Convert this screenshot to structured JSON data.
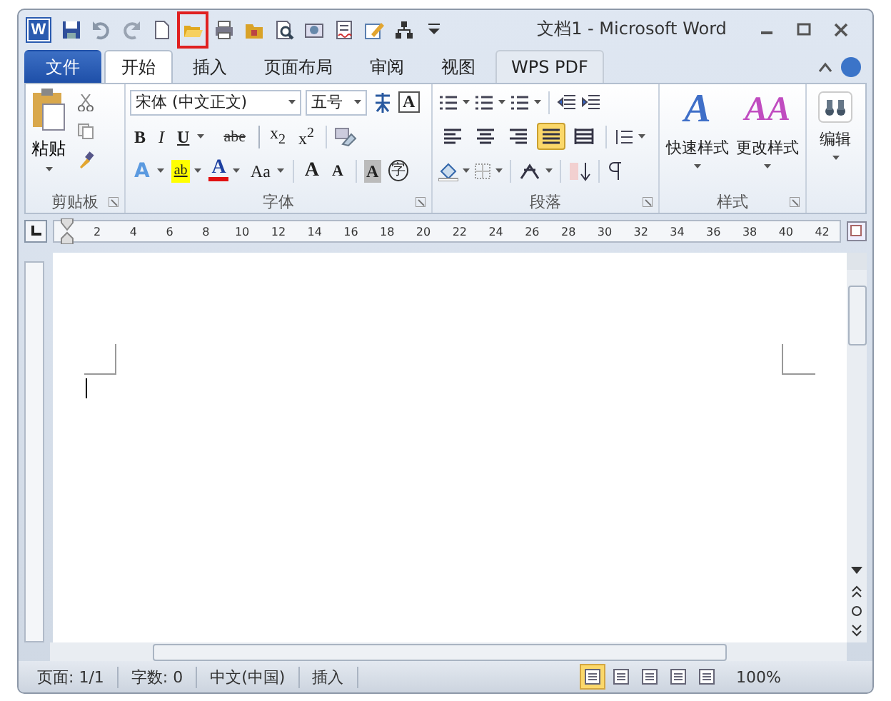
{
  "window": {
    "app_icon": "W",
    "title": "文档1 - Microsoft Word"
  },
  "quick_access": [
    {
      "kind": "save",
      "highlighted": false
    },
    {
      "kind": "undo",
      "highlighted": false
    },
    {
      "kind": "redo",
      "highlighted": false
    },
    {
      "kind": "new",
      "highlighted": false
    },
    {
      "kind": "open",
      "highlighted": true
    },
    {
      "kind": "print",
      "highlighted": false
    },
    {
      "kind": "folder",
      "highlighted": false
    },
    {
      "kind": "preview",
      "highlighted": false
    },
    {
      "kind": "picture",
      "highlighted": false
    },
    {
      "kind": "spell",
      "highlighted": false
    },
    {
      "kind": "edit",
      "highlighted": false
    },
    {
      "kind": "chart",
      "highlighted": false
    },
    {
      "kind": "customize",
      "highlighted": false
    }
  ],
  "tabs": [
    {
      "label": "文件",
      "kind": "file",
      "selected": false
    },
    {
      "label": "开始",
      "kind": "tab",
      "selected": true
    },
    {
      "label": "插入",
      "kind": "tab",
      "selected": false
    },
    {
      "label": "页面布局",
      "kind": "tab",
      "selected": false
    },
    {
      "label": "审阅",
      "kind": "tab",
      "selected": false
    },
    {
      "label": "视图",
      "kind": "tab",
      "selected": false
    },
    {
      "label": "WPS PDF",
      "kind": "boxed",
      "selected": false
    }
  ],
  "clipboard": {
    "paste": "粘贴",
    "label": "剪贴板"
  },
  "font": {
    "name": "宋体 (中文正文)",
    "size": "五号",
    "border_button": "A",
    "label": "字体",
    "row2": [
      {
        "label": "B",
        "kind": "bold",
        "dropdown": false,
        "sep": false
      },
      {
        "label": "I",
        "kind": "italic",
        "dropdown": false,
        "sep": false
      },
      {
        "label": "U",
        "kind": "underline",
        "dropdown": true,
        "sep": false
      },
      {
        "label": "abe",
        "kind": "strike",
        "dropdown": false,
        "sep": false
      },
      {
        "label": "x$_{2}$",
        "kind": "plain",
        "dropdown": false,
        "sep": false
      },
      {
        "label": "x$^{2}$",
        "kind": "plain",
        "dropdown": false,
        "sep": false
      }
    ],
    "row3": [
      {
        "label": "A",
        "kind": "effect",
        "dropdown": true,
        "sep": false
      },
      {
        "label": "ab",
        "kind": "highlight",
        "dropdown": true,
        "sep": false
      },
      {
        "label": "A",
        "kind": "color",
        "dropdown": true,
        "sep": false
      },
      {
        "label": "Aa",
        "kind": "plain",
        "dropdown": true,
        "sep": false
      },
      {
        "label": "A",
        "kind": "grow",
        "dropdown": false,
        "sep": true
      },
      {
        "label": "A",
        "kind": "shrink",
        "dropdown": false,
        "sep": false
      },
      {
        "label": "A",
        "kind": "shade",
        "dropdown": false,
        "sep": true
      },
      {
        "label": "字",
        "kind": "circle",
        "dropdown": false,
        "sep": false
      }
    ]
  },
  "paragraph": {
    "label": "段落",
    "align": [
      {
        "selected": false
      },
      {
        "selected": false
      },
      {
        "selected": false
      },
      {
        "selected": true
      },
      {
        "selected": false
      }
    ]
  },
  "styles": {
    "label": "样式",
    "items": [
      {
        "glyph": "A",
        "label": "快速样式"
      },
      {
        "glyph": "AA",
        "label": "更改样式"
      }
    ]
  },
  "editing": {
    "label": "编辑"
  },
  "ruler": [
    "2",
    "4",
    "6",
    "8",
    "10",
    "12",
    "14",
    "16",
    "18",
    "20",
    "22",
    "24",
    "26",
    "28",
    "30",
    "32",
    "34",
    "36",
    "38",
    "40",
    "42"
  ],
  "status_bar": {
    "items": [
      "页面: 1/1",
      "字数: 0",
      "中文(中国)",
      "插入"
    ],
    "views": [
      {
        "selected": true
      },
      {
        "selected": false
      },
      {
        "selected": false
      },
      {
        "selected": false
      },
      {
        "selected": false
      }
    ],
    "zoom": "100%"
  }
}
